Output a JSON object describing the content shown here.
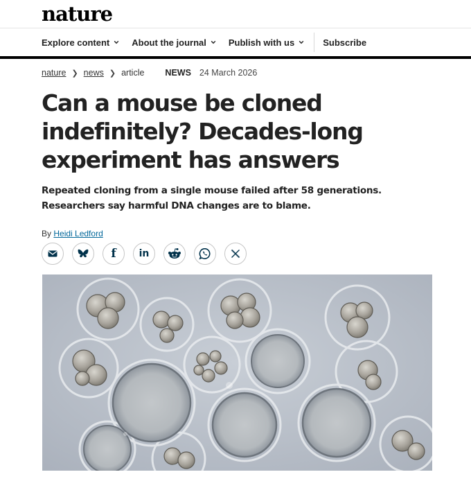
{
  "site": {
    "logo": "nature"
  },
  "nav": {
    "items": [
      {
        "label": "Explore content",
        "dropdown": true
      },
      {
        "label": "About the journal",
        "dropdown": true
      },
      {
        "label": "Publish with us",
        "dropdown": true
      }
    ],
    "subscribe": "Subscribe"
  },
  "breadcrumb": {
    "home": "nature",
    "section": "news",
    "current": "article"
  },
  "article": {
    "type": "NEWS",
    "date": "24 March 2026",
    "title": "Can a mouse be cloned indefinitely? Decades-long experiment has answers",
    "standfirst": "Repeated cloning from a single mouse failed after 58 generations. Researchers say harmful DNA changes are to blame.",
    "byline_prefix": "By",
    "author": "Heidi Ledford"
  },
  "share": {
    "icons": [
      "email-icon",
      "bluesky-icon",
      "facebook-icon",
      "linkedin-icon",
      "reddit-icon",
      "whatsapp-icon",
      "x-icon"
    ]
  },
  "colors": {
    "brand": "#000000",
    "link": "#006699",
    "icon": "#01324b"
  }
}
